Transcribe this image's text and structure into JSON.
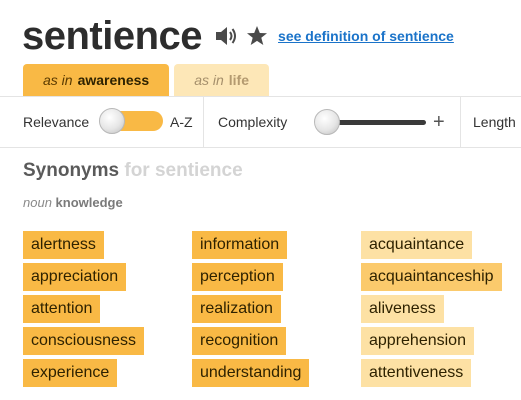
{
  "header": {
    "word": "sentience",
    "definition_link": "see definition of sentience",
    "speaker_icon": "speaker-icon",
    "star_icon": "star-icon"
  },
  "tabs": [
    {
      "as_in": "as in",
      "sense": "awareness",
      "active": true
    },
    {
      "as_in": "as in",
      "sense": "life",
      "active": false
    }
  ],
  "filters": {
    "relevance_label": "Relevance",
    "az_label": "A-Z",
    "sort_toggle_state": "relevance",
    "complexity_label": "Complexity",
    "complexity_level": 0,
    "length_label": "Length"
  },
  "synonyms": {
    "title": "Synonyms",
    "for_word": "for sentience",
    "part_of_speech": "noun",
    "sense_word": "knowledge",
    "columns": [
      [
        "alertness",
        "appreciation",
        "attention",
        "consciousness",
        "experience"
      ],
      [
        "information",
        "perception",
        "realization",
        "recognition",
        "understanding"
      ],
      [
        "acquaintance",
        "acquaintanceship",
        "aliveness",
        "apprehension",
        "attentiveness"
      ]
    ]
  },
  "colors": {
    "strong_relevance": "#f9b945",
    "medium_relevance": "#fbca6c",
    "weak_relevance": "#fde1a4",
    "link": "#1a73c9"
  }
}
